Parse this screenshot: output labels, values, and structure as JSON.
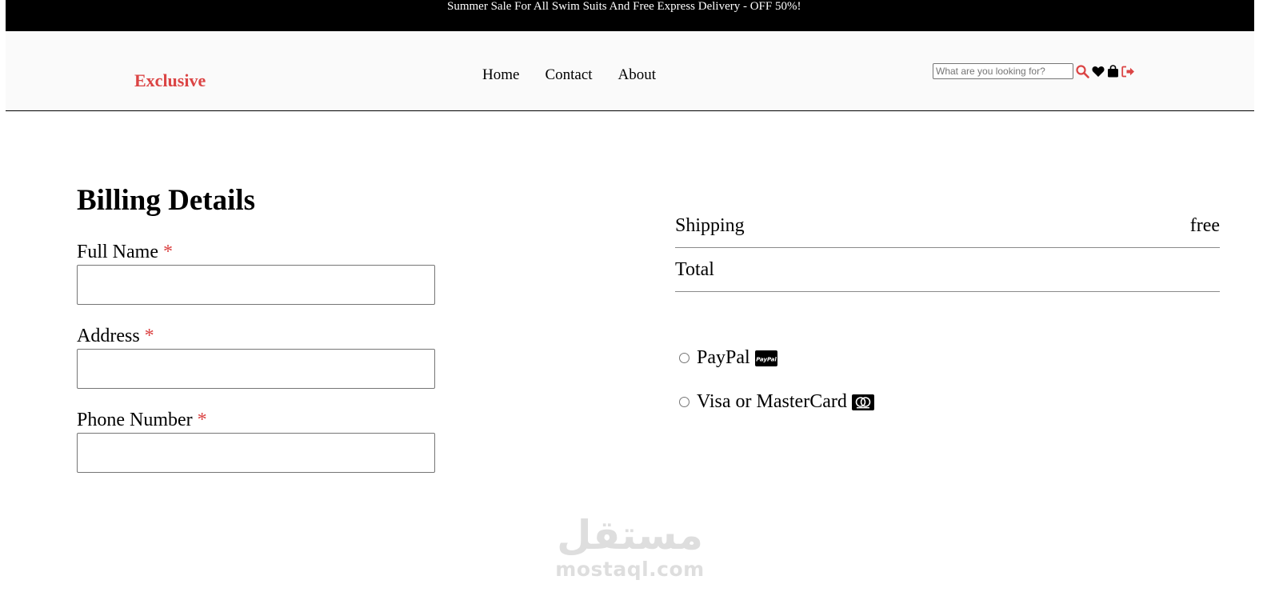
{
  "banner": {
    "text": "Summer Sale For All Swim Suits And Free Express Delivery - OFF 50%!"
  },
  "header": {
    "logo": "Exclusive",
    "nav": [
      "Home",
      "Contact",
      "About"
    ],
    "search_placeholder": "What are you looking for?",
    "icons": [
      "search-icon",
      "heart-icon",
      "shopping-bag-icon",
      "sign-out-icon"
    ],
    "accent_color": "#db4444"
  },
  "billing": {
    "title": "Billing Details",
    "fields": [
      {
        "label": "Full Name",
        "required_mark": "*",
        "value": ""
      },
      {
        "label": "Address",
        "required_mark": "*",
        "value": ""
      },
      {
        "label": "Phone Number",
        "required_mark": "*",
        "value": ""
      }
    ]
  },
  "summary": {
    "shipping_label": "Shipping",
    "shipping_value": "free",
    "total_label": "Total",
    "total_value": ""
  },
  "payment": {
    "options": [
      {
        "label": "PayPal",
        "icon": "paypal-icon",
        "selected": false
      },
      {
        "label": "Visa or MasterCard",
        "icon": "mastercard-icon",
        "selected": false
      }
    ]
  },
  "watermark": {
    "arabic": "مستقل",
    "latin": "mostaql.com"
  }
}
